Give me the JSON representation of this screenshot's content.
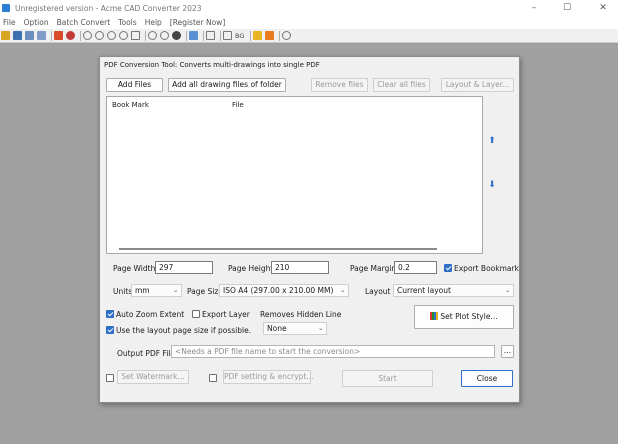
{
  "window": {
    "title": "Unregistered version - Acme CAD Converter 2023",
    "controls": {
      "minimize": "–",
      "maximize": "☐",
      "close": "✕"
    }
  },
  "menu": [
    "File",
    "Option",
    "Batch Convert",
    "Tools",
    "Help",
    "[Register Now]"
  ],
  "toolbar": {
    "bg_label": "BG"
  },
  "dialog": {
    "title": "PDF Conversion Tool: Converts multi-drawings into single PDF",
    "buttons": {
      "add_files": "Add Files",
      "add_folder": "Add all drawing files of folder",
      "remove_files": "Remove files",
      "clear_files": "Clear all files",
      "layout_layer": "Layout & Layer...",
      "set_plot_style": "Set Plot Style...",
      "browse": "...",
      "set_watermark": "Set Watermark...",
      "pdf_setting": "PDF setting & encrypt...",
      "start": "Start",
      "close": "Close"
    },
    "list": {
      "columns": [
        "Book Mark",
        "File"
      ],
      "rows": []
    },
    "arrows": {
      "up": "⬆",
      "down": "⬇"
    },
    "page_width": {
      "label": "Page Width",
      "value": "297"
    },
    "page_height": {
      "label": "Page Height",
      "value": "210"
    },
    "page_margin": {
      "label": "Page Margin",
      "value": "0.2"
    },
    "export_bookmark": {
      "label": "Export Bookmark",
      "checked": true
    },
    "units": {
      "label": "Units",
      "value": "mm"
    },
    "page_size": {
      "label": "Page Size",
      "value": "ISO A4 (297.00 x 210.00 MM)"
    },
    "layout": {
      "label": "Layout",
      "value": "Current layout"
    },
    "auto_zoom_extent": {
      "label": "Auto Zoom Extent",
      "checked": true
    },
    "export_layer": {
      "label": "Export Layer",
      "checked": false
    },
    "removes_hidden_line": {
      "label": "Removes Hidden Line",
      "value": "None"
    },
    "use_layout_page_size": {
      "label": "Use the layout page size if possible.",
      "checked": true
    },
    "output_pdf": {
      "label": "Output PDF File",
      "placeholder": "<Needs a PDF file name to start the conversion>"
    },
    "watermark_checked": false,
    "pdf_setting_checked": false
  },
  "colors": {
    "accent": "#2f6fc7",
    "desktop": "#a0a0a0",
    "dialog_bg": "#f0f0f0"
  }
}
